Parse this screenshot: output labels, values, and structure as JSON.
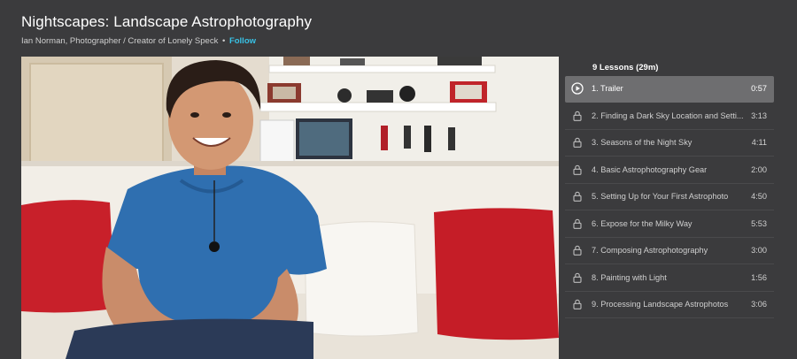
{
  "course": {
    "title": "Nightscapes: Landscape Astrophotography",
    "author": "Ian Norman, Photographer / Creator of Lonely Speck",
    "separator": "•",
    "follow_label": "Follow"
  },
  "video": {
    "description_icon": "video-thumbnail"
  },
  "lessons": {
    "header": "9 Lessons (29m)",
    "items": [
      {
        "title": "1. Trailer",
        "duration": "0:57",
        "icon": "play-icon",
        "active": true
      },
      {
        "title": "2. Finding a Dark Sky Location and Setti...",
        "duration": "3:13",
        "icon": "lock-icon",
        "active": false
      },
      {
        "title": "3. Seasons of the Night Sky",
        "duration": "4:11",
        "icon": "lock-icon",
        "active": false
      },
      {
        "title": "4. Basic Astrophotography Gear",
        "duration": "2:00",
        "icon": "lock-icon",
        "active": false
      },
      {
        "title": "5. Setting Up for Your First Astrophoto",
        "duration": "4:50",
        "icon": "lock-icon",
        "active": false
      },
      {
        "title": "6. Expose for the Milky Way",
        "duration": "5:53",
        "icon": "lock-icon",
        "active": false
      },
      {
        "title": "7. Composing Astrophotography",
        "duration": "3:00",
        "icon": "lock-icon",
        "active": false
      },
      {
        "title": "8. Painting with Light",
        "duration": "1:56",
        "icon": "lock-icon",
        "active": false
      },
      {
        "title": "9. Processing Landscape Astrophotos",
        "duration": "3:06",
        "icon": "lock-icon",
        "active": false
      }
    ]
  },
  "colors": {
    "background": "#3b3b3d",
    "accent": "#38c2e6",
    "active_row": "#6e6e70"
  }
}
